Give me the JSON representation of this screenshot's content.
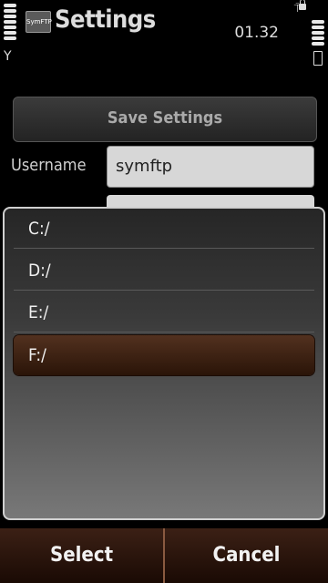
{
  "status": {
    "title": "Settings",
    "clock": "01.32",
    "app_icon_label": "SymFTP"
  },
  "content": {
    "save_button": "Save Settings",
    "username_label": "Username",
    "username_value": "symftp"
  },
  "popup": {
    "drives": [
      "C:/",
      "D:/",
      "E:/",
      "F:/"
    ],
    "selected_index": 3
  },
  "softkeys": {
    "left": "Select",
    "right": "Cancel"
  },
  "colors": {
    "selection": "#3e2112",
    "softkey_bar": "#2a140a"
  }
}
